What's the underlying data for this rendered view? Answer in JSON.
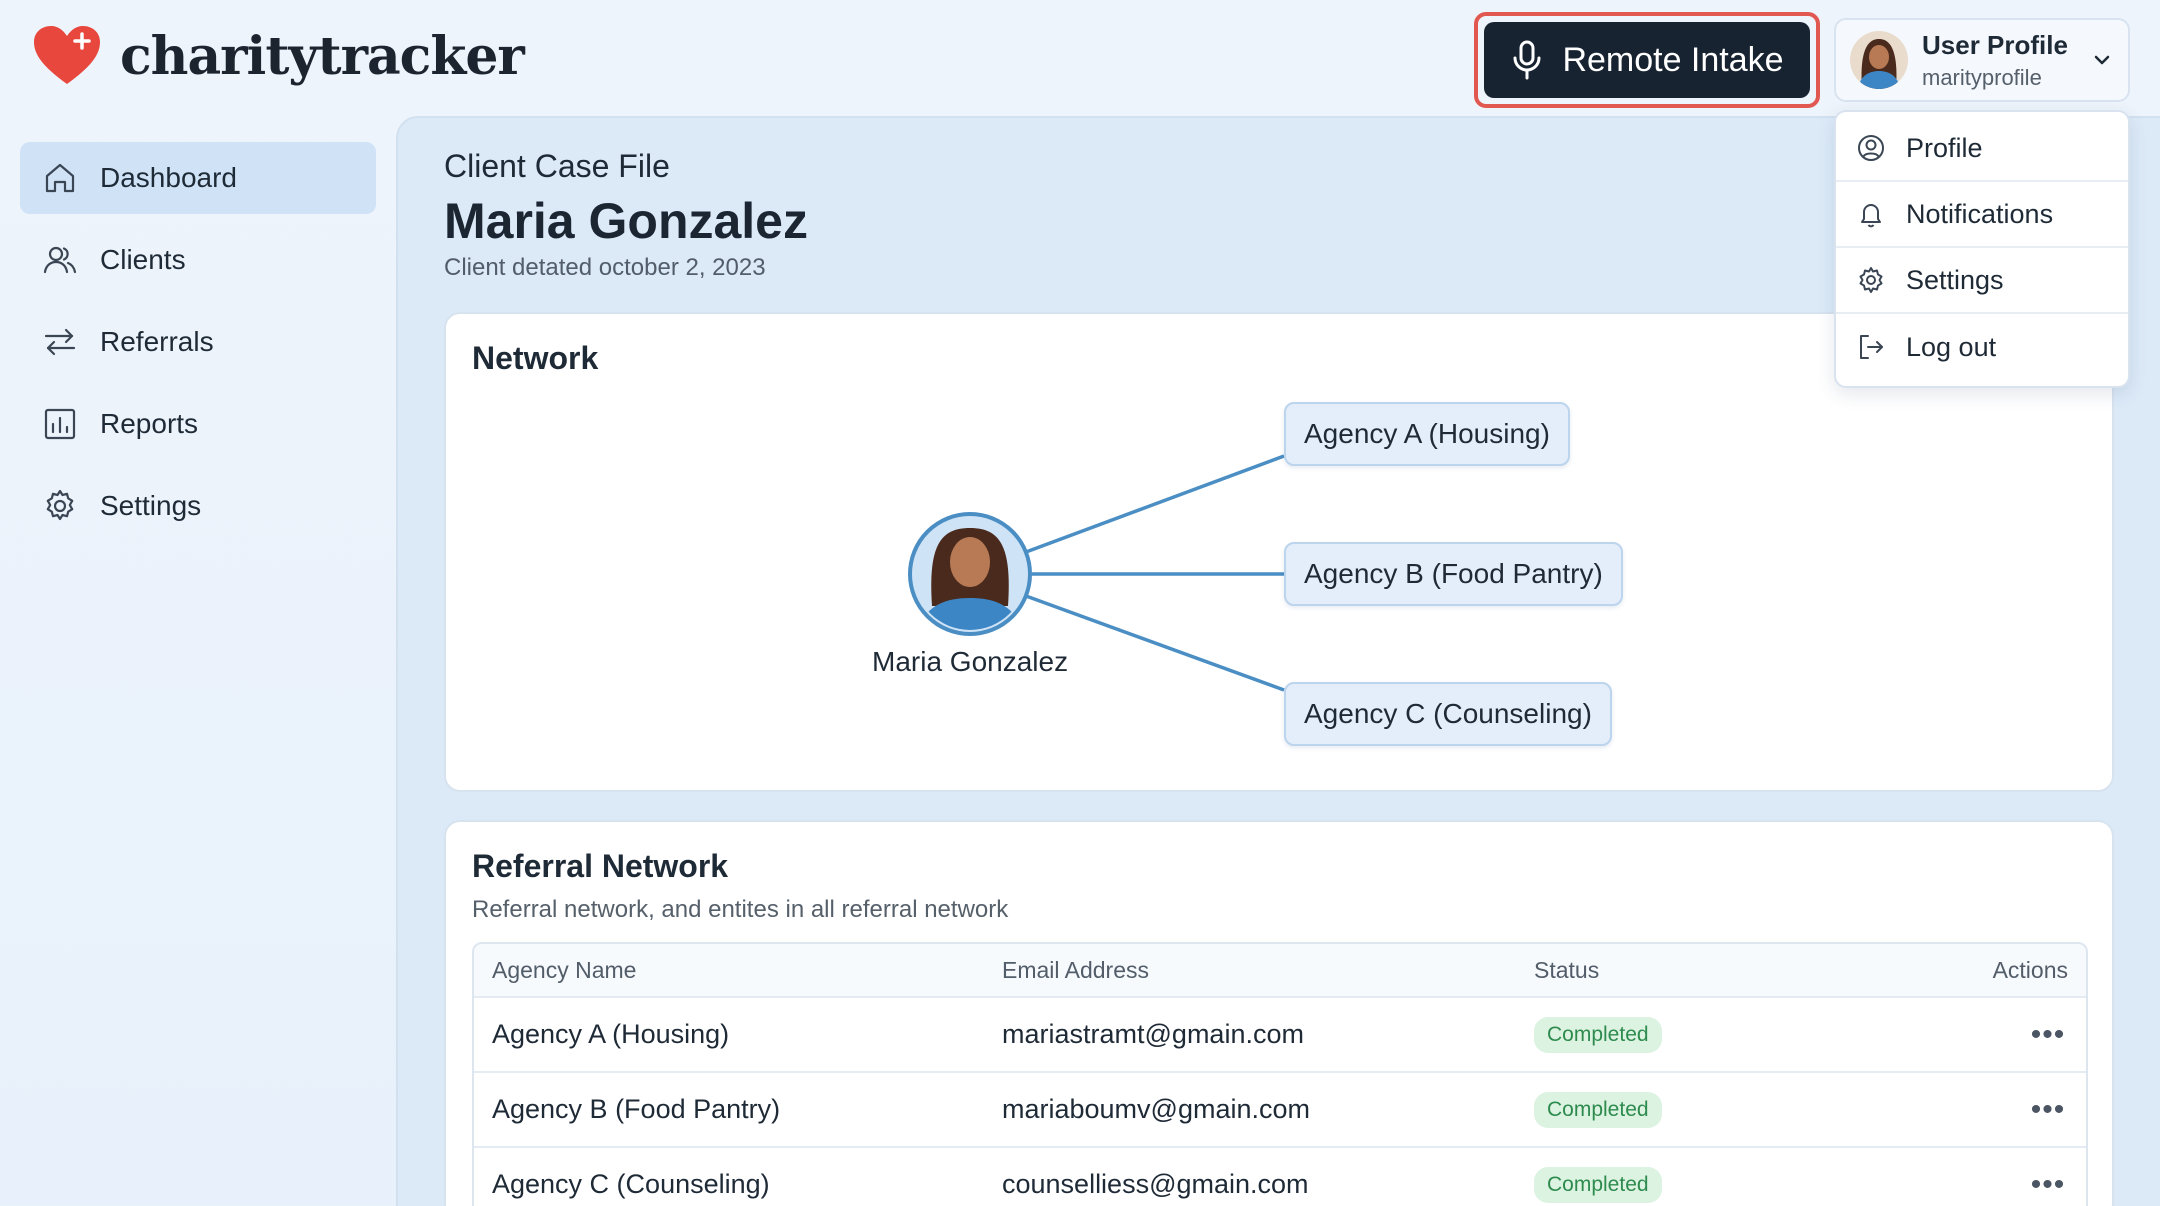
{
  "app": {
    "name": "charitytracker"
  },
  "header": {
    "remote_intake_label": "Remote Intake",
    "profile": {
      "name": "User Profile",
      "handle": "marityprofile"
    }
  },
  "dropdown": {
    "items": [
      {
        "label": "Profile",
        "icon": "user-circle-icon"
      },
      {
        "label": "Notifications",
        "icon": "bell-icon"
      },
      {
        "label": "Settings",
        "icon": "gear-icon"
      },
      {
        "label": "Log out",
        "icon": "logout-icon"
      }
    ]
  },
  "sidebar": {
    "items": [
      {
        "label": "Dashboard",
        "icon": "home-icon",
        "active": true
      },
      {
        "label": "Clients",
        "icon": "users-icon"
      },
      {
        "label": "Referrals",
        "icon": "arrows-icon"
      },
      {
        "label": "Reports",
        "icon": "chart-icon"
      },
      {
        "label": "Settings",
        "icon": "gear-icon"
      }
    ]
  },
  "case": {
    "label": "Client Case File",
    "name": "Maria Gonzalez",
    "date": "Client detated october 2, 2023"
  },
  "network": {
    "title": "Network",
    "center": "Maria Gonzalez",
    "agencies": [
      "Agency A (Housing)",
      "Agency B (Food Pantry)",
      "Agency C (Counseling)"
    ]
  },
  "referral": {
    "title": "Referral Network",
    "subtitle": "Referral network, and entites in all referral network",
    "columns": [
      "Agency Name",
      "Email Address",
      "Status",
      "Actions"
    ],
    "rows": [
      {
        "agency": "Agency A (Housing)",
        "email": "mariastramt@gmain.com",
        "status": "Completed"
      },
      {
        "agency": "Agency B (Food Pantry)",
        "email": "mariabоumv@gmain.com",
        "status": "Completed"
      },
      {
        "agency": "Agency C (Counseling)",
        "email": "counselliess@gmain.com",
        "status": "Completed"
      }
    ],
    "actions_glyph": "•••"
  },
  "colors": {
    "accent": "#172330",
    "highlight": "#e0584f",
    "active_nav": "#cfe2f6",
    "edge": "#4a8ec4",
    "badge_bg": "#dcf3e2",
    "badge_text": "#2e8b4e"
  }
}
